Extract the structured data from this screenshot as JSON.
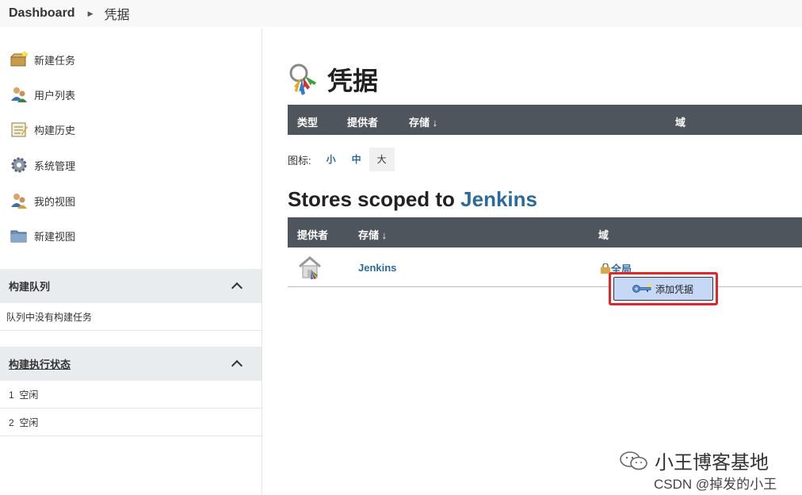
{
  "breadcrumb": {
    "root": "Dashboard",
    "current": "凭据"
  },
  "sidebar": {
    "tasks": [
      {
        "label": "新建任务",
        "icon": "new-item-icon"
      },
      {
        "label": "用户列表",
        "icon": "people-icon"
      },
      {
        "label": "构建历史",
        "icon": "notepad-icon"
      },
      {
        "label": "系统管理",
        "icon": "gear-icon"
      },
      {
        "label": "我的视图",
        "icon": "user-icon"
      },
      {
        "label": "新建视图",
        "icon": "folder-icon"
      }
    ],
    "queue": {
      "title": "构建队列",
      "empty": "队列中没有构建任务"
    },
    "executors": {
      "title": "构建执行状态",
      "items": [
        "1  空闲",
        "2  空闲"
      ]
    }
  },
  "main": {
    "title": "凭据",
    "table1_headers": {
      "type": "类型",
      "provider": "提供者",
      "store": "存储 ↓",
      "domain": "域"
    },
    "icon_label": "图标:",
    "icon_sizes": {
      "small": "小",
      "medium": "中",
      "large": "大"
    },
    "stores_heading_prefix": "Stores scoped to ",
    "stores_heading_link": "Jenkins",
    "table2_headers": {
      "provider": "提供者",
      "store": "存储 ↓",
      "domain": "域"
    },
    "store_row": {
      "store": "Jenkins",
      "domain": "全局"
    },
    "context_menu": {
      "add_credentials": "添加凭据"
    }
  },
  "watermark": {
    "line1": "小王博客基地",
    "line2": "CSDN @掉发的小王"
  },
  "colors": {
    "header_bg": "#4f555d",
    "link": "#2b6a9a",
    "highlight": "#e0252b",
    "panel_bg": "#e9ecef"
  }
}
